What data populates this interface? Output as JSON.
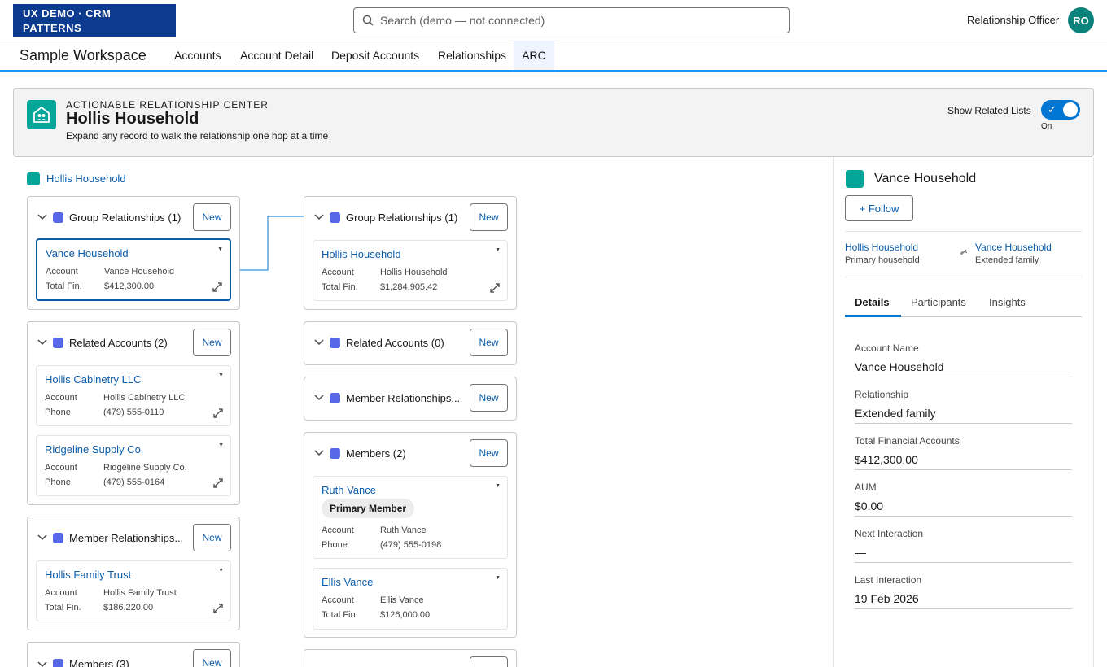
{
  "header": {
    "logo_line1": "UX DEMO · CRM",
    "logo_line2": "PATTERNS",
    "search_placeholder": "Search (demo — not connected)",
    "user_role": "Relationship Officer",
    "avatar_initials": "RO"
  },
  "nav": {
    "app_name": "Sample Workspace",
    "tabs": [
      "Accounts",
      "Account Detail",
      "Deposit Accounts",
      "Relationships",
      "ARC"
    ],
    "active_tab": "ARC"
  },
  "page_header": {
    "eyebrow": "ACTIONABLE RELATIONSHIP CENTER",
    "title": "Hollis Household",
    "subtitle": "Expand any record to walk the relationship one hop at a time",
    "toggle_label": "Show Related Lists",
    "toggle_state": "On"
  },
  "root_link": "Hollis Household",
  "new_label": "New",
  "col1": {
    "group": {
      "title": "Group Relationships (1)",
      "rec": {
        "name": "Vance Household",
        "r1l": "Account",
        "r1v": "Vance Household",
        "r2l": "Total Fin.",
        "r2v": "$412,300.00"
      }
    },
    "related": {
      "title": "Related Accounts (2)",
      "rec1": {
        "name": "Hollis Cabinetry LLC",
        "r1l": "Account",
        "r1v": "Hollis Cabinetry LLC",
        "r2l": "Phone",
        "r2v": "(479) 555-0110"
      },
      "rec2": {
        "name": "Ridgeline Supply Co.",
        "r1l": "Account",
        "r1v": "Ridgeline Supply Co.",
        "r2l": "Phone",
        "r2v": "(479) 555-0164"
      }
    },
    "member_rel": {
      "title": "Member Relationships...",
      "rec": {
        "name": "Hollis Family Trust",
        "r1l": "Account",
        "r1v": "Hollis Family Trust",
        "r2l": "Total Fin.",
        "r2v": "$186,220.00"
      }
    },
    "members": {
      "title": "Members (3)"
    }
  },
  "col2": {
    "group": {
      "title": "Group Relationships (1)",
      "rec": {
        "name": "Hollis Household",
        "r1l": "Account",
        "r1v": "Hollis Household",
        "r2l": "Total Fin.",
        "r2v": "$1,284,905.42"
      }
    },
    "related": {
      "title": "Related Accounts (0)"
    },
    "member_rel": {
      "title": "Member Relationships..."
    },
    "members": {
      "title": "Members (2)",
      "rec1": {
        "name": "Ruth Vance",
        "pill": "Primary Member",
        "r1l": "Account",
        "r1v": "Ruth Vance",
        "r2l": "Phone",
        "r2v": "(479) 555-0198"
      },
      "rec2": {
        "name": "Ellis Vance",
        "r1l": "Account",
        "r1v": "Ellis Vance",
        "r2l": "Total Fin.",
        "r2v": "$126,000.00"
      }
    }
  },
  "panel": {
    "title": "Vance Household",
    "follow": "+ Follow",
    "link1": "Hollis Household",
    "link1_sub": "Primary household",
    "link2": "Vance Household",
    "link2_sub": "Extended family",
    "tabs": [
      "Details",
      "Participants",
      "Insights"
    ],
    "fields": [
      {
        "label": "Account Name",
        "value": "Vance Household"
      },
      {
        "label": "Relationship",
        "value": "Extended family"
      },
      {
        "label": "Total Financial Accounts",
        "value": "$412,300.00"
      },
      {
        "label": "AUM",
        "value": "$0.00"
      },
      {
        "label": "Next Interaction",
        "value": "—"
      },
      {
        "label": "Last Interaction",
        "value": "19 Feb 2026"
      }
    ]
  },
  "colors": {
    "brand": "#0b3a8f",
    "accent": "#0176d3",
    "teal": "#06a59a",
    "indigo": "#5867e8",
    "link": "#0b5cab"
  },
  "icons": [
    "search-icon",
    "household-icon",
    "chevron-down-icon",
    "group-icon",
    "expand-icon",
    "caret-down-icon",
    "check-icon",
    "link-icon"
  ]
}
